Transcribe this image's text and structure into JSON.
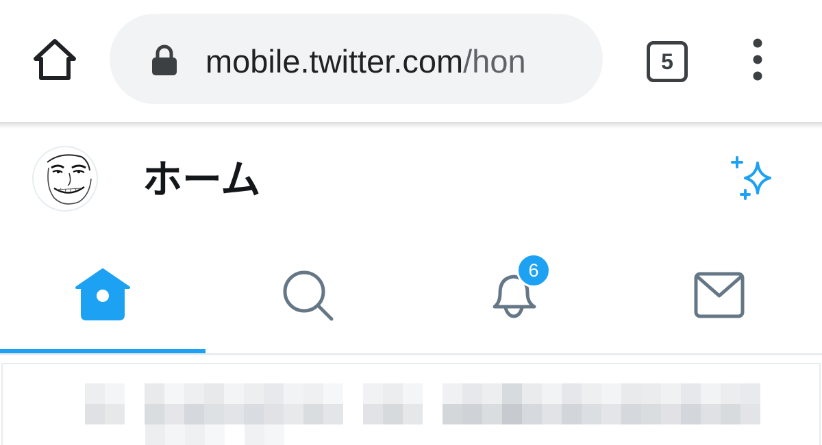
{
  "browser": {
    "url_host": "mobile.twitter.com",
    "url_path": "/hon",
    "tab_count": "5",
    "icons": {
      "home": "home-icon",
      "lock": "lock-icon",
      "tabs": "tab-switcher-icon",
      "menu": "more-vert-icon"
    },
    "omnibox_color": "#f1f3f4"
  },
  "header": {
    "title": "ホーム",
    "avatar_icon": "avatar",
    "sparkle_icon": "sparkle-icon"
  },
  "nav": {
    "tabs": [
      {
        "id": "home",
        "icon": "home-icon",
        "active": true
      },
      {
        "id": "search",
        "icon": "search-icon",
        "active": false
      },
      {
        "id": "notifications",
        "icon": "bell-icon",
        "active": false,
        "badge": "6"
      },
      {
        "id": "messages",
        "icon": "mail-icon",
        "active": false
      }
    ]
  },
  "colors": {
    "accent": "#1da1f2",
    "icon_inactive": "#657786",
    "divider": "#e6ecf0",
    "title": "#14171a"
  }
}
